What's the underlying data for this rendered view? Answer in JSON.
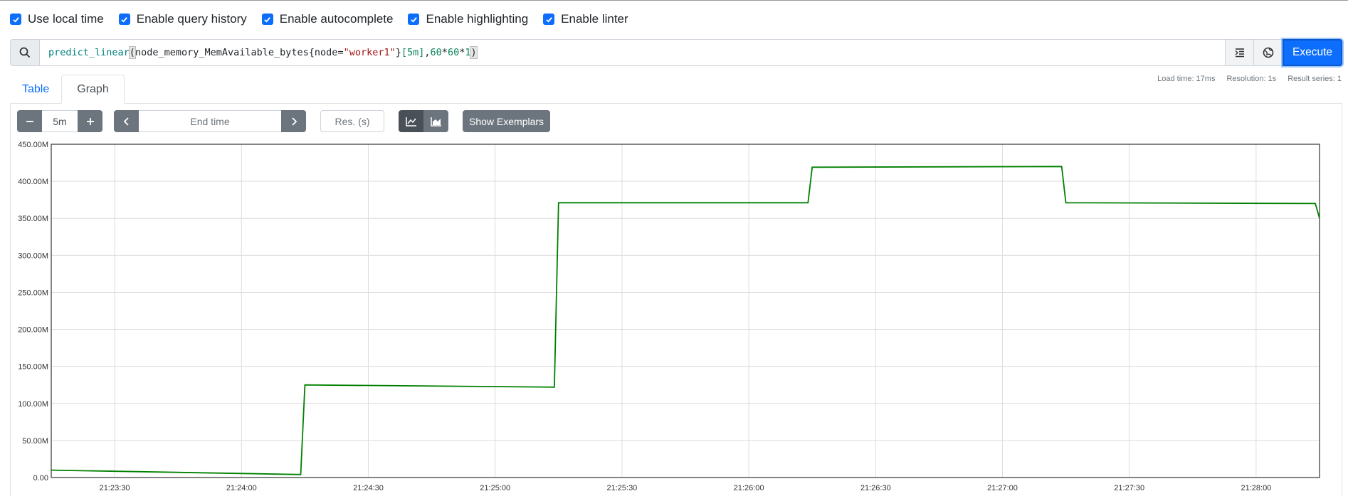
{
  "options": [
    {
      "label": "Use local time",
      "checked": true
    },
    {
      "label": "Enable query history",
      "checked": true
    },
    {
      "label": "Enable autocomplete",
      "checked": true
    },
    {
      "label": "Enable highlighting",
      "checked": true
    },
    {
      "label": "Enable linter",
      "checked": true
    }
  ],
  "query": {
    "fn": "predict_linear",
    "open": "(",
    "metric": "node_memory_MemAvailable_bytes",
    "lbrace": "{",
    "label_name": "node",
    "eq": "=",
    "label_value": "\"worker1\"",
    "rbrace": "}",
    "range": "[5m]",
    "comma": ",",
    "n1": "60",
    "op1": "*",
    "n2": "60",
    "op2": "*",
    "n3": "1",
    "close": ")"
  },
  "execute_label": "Execute",
  "tabs": [
    {
      "label": "Table",
      "active": false
    },
    {
      "label": "Graph",
      "active": true
    }
  ],
  "stats": {
    "load_time": "Load time: 17ms",
    "resolution": "Resolution: 1s",
    "result_series": "Result series: 1"
  },
  "controls": {
    "range_value": "5m",
    "end_time_placeholder": "End time",
    "resolution_placeholder": "Res. (s)",
    "exemplars_label": "Show Exemplars"
  },
  "icons": {
    "search": "search-icon",
    "format": "format-query-icon",
    "metrics_explorer": "globe-icon",
    "minus": "minus-icon",
    "plus": "plus-icon",
    "prev": "chevron-left-icon",
    "next": "chevron-right-icon",
    "line_mode": "line-chart-icon",
    "stacked_mode": "area-chart-icon"
  },
  "colors": {
    "accent": "#0d6efd",
    "series": "#008000",
    "button": "#6c757d"
  },
  "chart_data": {
    "type": "line",
    "title": "",
    "xlabel": "",
    "ylabel": "",
    "x_ticks": [
      "21:23:30",
      "21:24:00",
      "21:24:30",
      "21:25:00",
      "21:25:30",
      "21:26:00",
      "21:26:30",
      "21:27:00",
      "21:27:30",
      "21:28:00"
    ],
    "y_ticks": [
      "0.00",
      "50.00M",
      "100.00M",
      "150.00M",
      "200.00M",
      "250.00M",
      "300.00M",
      "350.00M",
      "400.00M",
      "450.00M"
    ],
    "ylim": [
      0,
      450000000
    ],
    "xlim": [
      "21:23:15",
      "21:28:15"
    ],
    "grid": true,
    "series": [
      {
        "x": [
          "21:23:15",
          "21:24:14",
          "21:24:15",
          "21:25:14",
          "21:25:15",
          "21:26:14",
          "21:26:15",
          "21:27:14",
          "21:27:15",
          "21:28:14",
          "21:28:15"
        ],
        "values": [
          10000000,
          4000000,
          125000000,
          122000000,
          371000000,
          371000000,
          419000000,
          420000000,
          371000000,
          370000000,
          350000000
        ]
      }
    ]
  }
}
